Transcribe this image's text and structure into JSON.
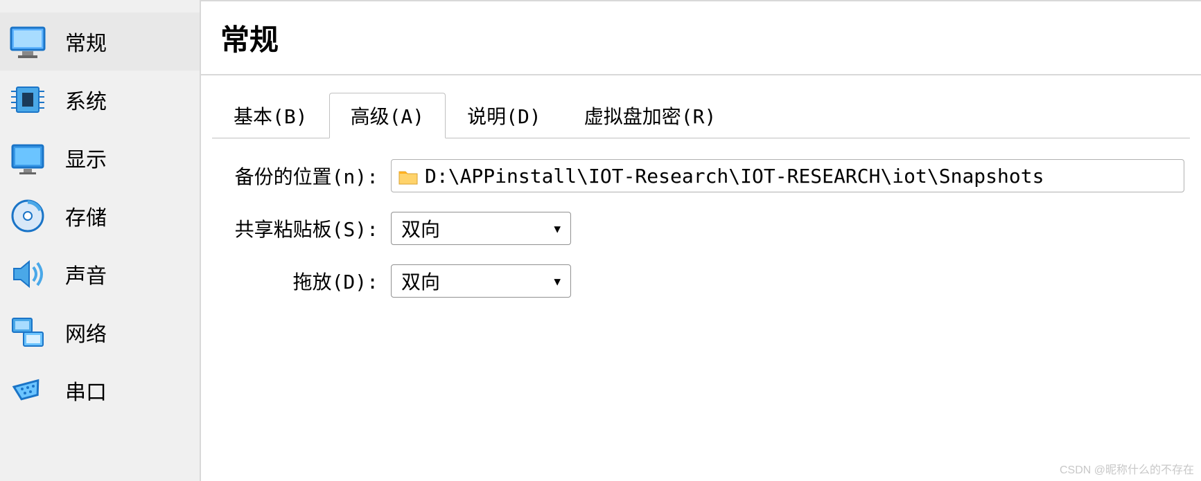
{
  "sidebar": {
    "items": [
      {
        "label": "常规",
        "icon": "monitor"
      },
      {
        "label": "系统",
        "icon": "chip"
      },
      {
        "label": "显示",
        "icon": "display"
      },
      {
        "label": "存储",
        "icon": "disk"
      },
      {
        "label": "声音",
        "icon": "speaker"
      },
      {
        "label": "网络",
        "icon": "network"
      },
      {
        "label": "串口",
        "icon": "serial"
      }
    ],
    "selected_index": 0
  },
  "header": {
    "title": "常规"
  },
  "tabs": {
    "items": [
      {
        "label": "基本(B)"
      },
      {
        "label": "高级(A)"
      },
      {
        "label": "说明(D)"
      },
      {
        "label": "虚拟盘加密(R)"
      }
    ],
    "active_index": 1
  },
  "form": {
    "snapshot_location_label": "备份的位置(n):",
    "snapshot_location_value": "D:\\APPinstall\\IOT-Research\\IOT-RESEARCH\\iot\\Snapshots",
    "clipboard_label": "共享粘贴板(S):",
    "clipboard_value": "双向",
    "dragdrop_label": "拖放(D):",
    "dragdrop_value": "双向"
  },
  "watermark": "CSDN @昵称什么的不存在"
}
